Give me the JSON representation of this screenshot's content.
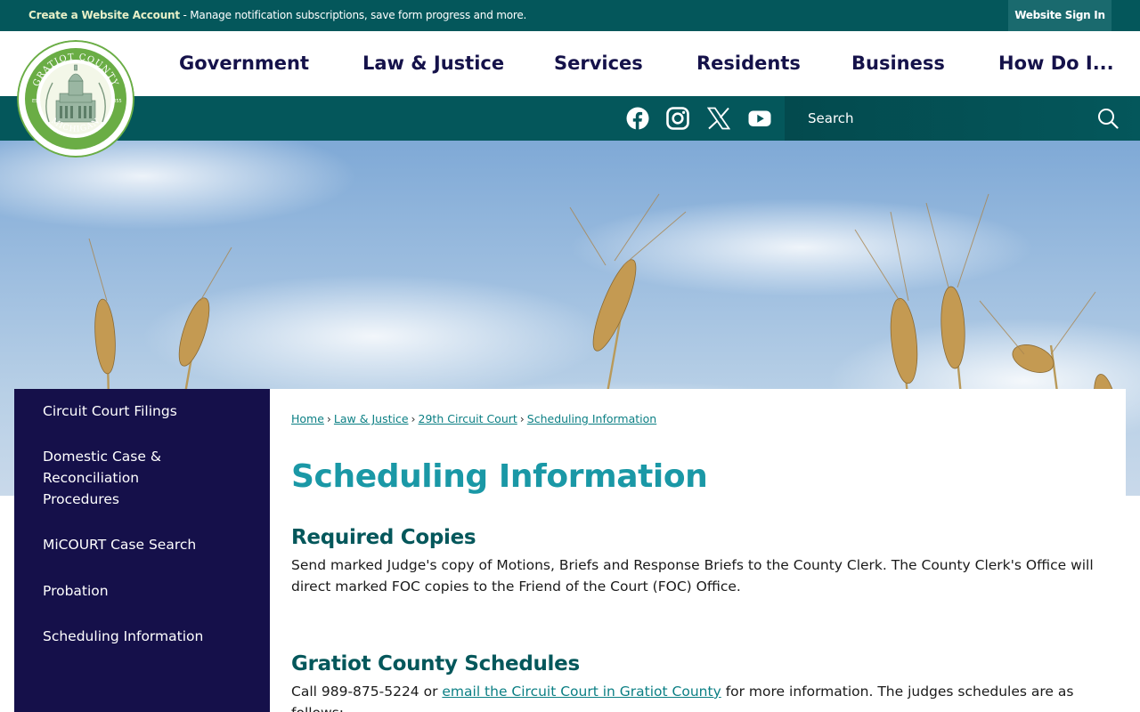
{
  "topbar": {
    "create_account_label": "Create a Website Account",
    "message": " - Manage notification subscriptions, save form progress and more.",
    "signin_label": "Website Sign In"
  },
  "logo": {
    "ring_top": "GRATIOT COUNTY",
    "ring_bottom": "MICHIGAN",
    "est": "EST.",
    "year": "1855"
  },
  "nav": [
    {
      "label": "Government"
    },
    {
      "label": "Law & Justice"
    },
    {
      "label": "Services"
    },
    {
      "label": "Residents"
    },
    {
      "label": "Business"
    },
    {
      "label": "How Do I..."
    }
  ],
  "social": [
    "facebook-icon",
    "instagram-icon",
    "x-icon",
    "youtube-icon"
  ],
  "search": {
    "placeholder": "Search"
  },
  "sidebar": {
    "items": [
      {
        "label": "Circuit Court Filings"
      },
      {
        "label": "Domestic Case & Reconciliation Procedures"
      },
      {
        "label": "MiCOURT Case Search"
      },
      {
        "label": "Probation"
      },
      {
        "label": "Scheduling Information"
      }
    ]
  },
  "breadcrumb": [
    {
      "label": "Home"
    },
    {
      "label": "Law & Justice"
    },
    {
      "label": "29th Circuit Court"
    },
    {
      "label": "Scheduling Information"
    }
  ],
  "main": {
    "title": "Scheduling Information",
    "section1": {
      "heading": "Required Copies",
      "text": "Send marked Judge's copy of Motions, Briefs and Response Briefs to the County Clerk. The County Clerk's Office will direct marked FOC copies to the Friend of the Court (FOC) Office."
    },
    "section2": {
      "heading": "Gratiot County Schedules",
      "text_before": "Call 989-875-5224 or ",
      "link": "email the Circuit Court in Gratiot County",
      "text_after": " for more information. The judges schedules are as follows:"
    }
  },
  "colors": {
    "teal_dark": "#04575b",
    "navy": "#15104a",
    "title_teal": "#1a98a6",
    "link_teal": "#0b7f84",
    "logo_green": "#6aad45"
  }
}
